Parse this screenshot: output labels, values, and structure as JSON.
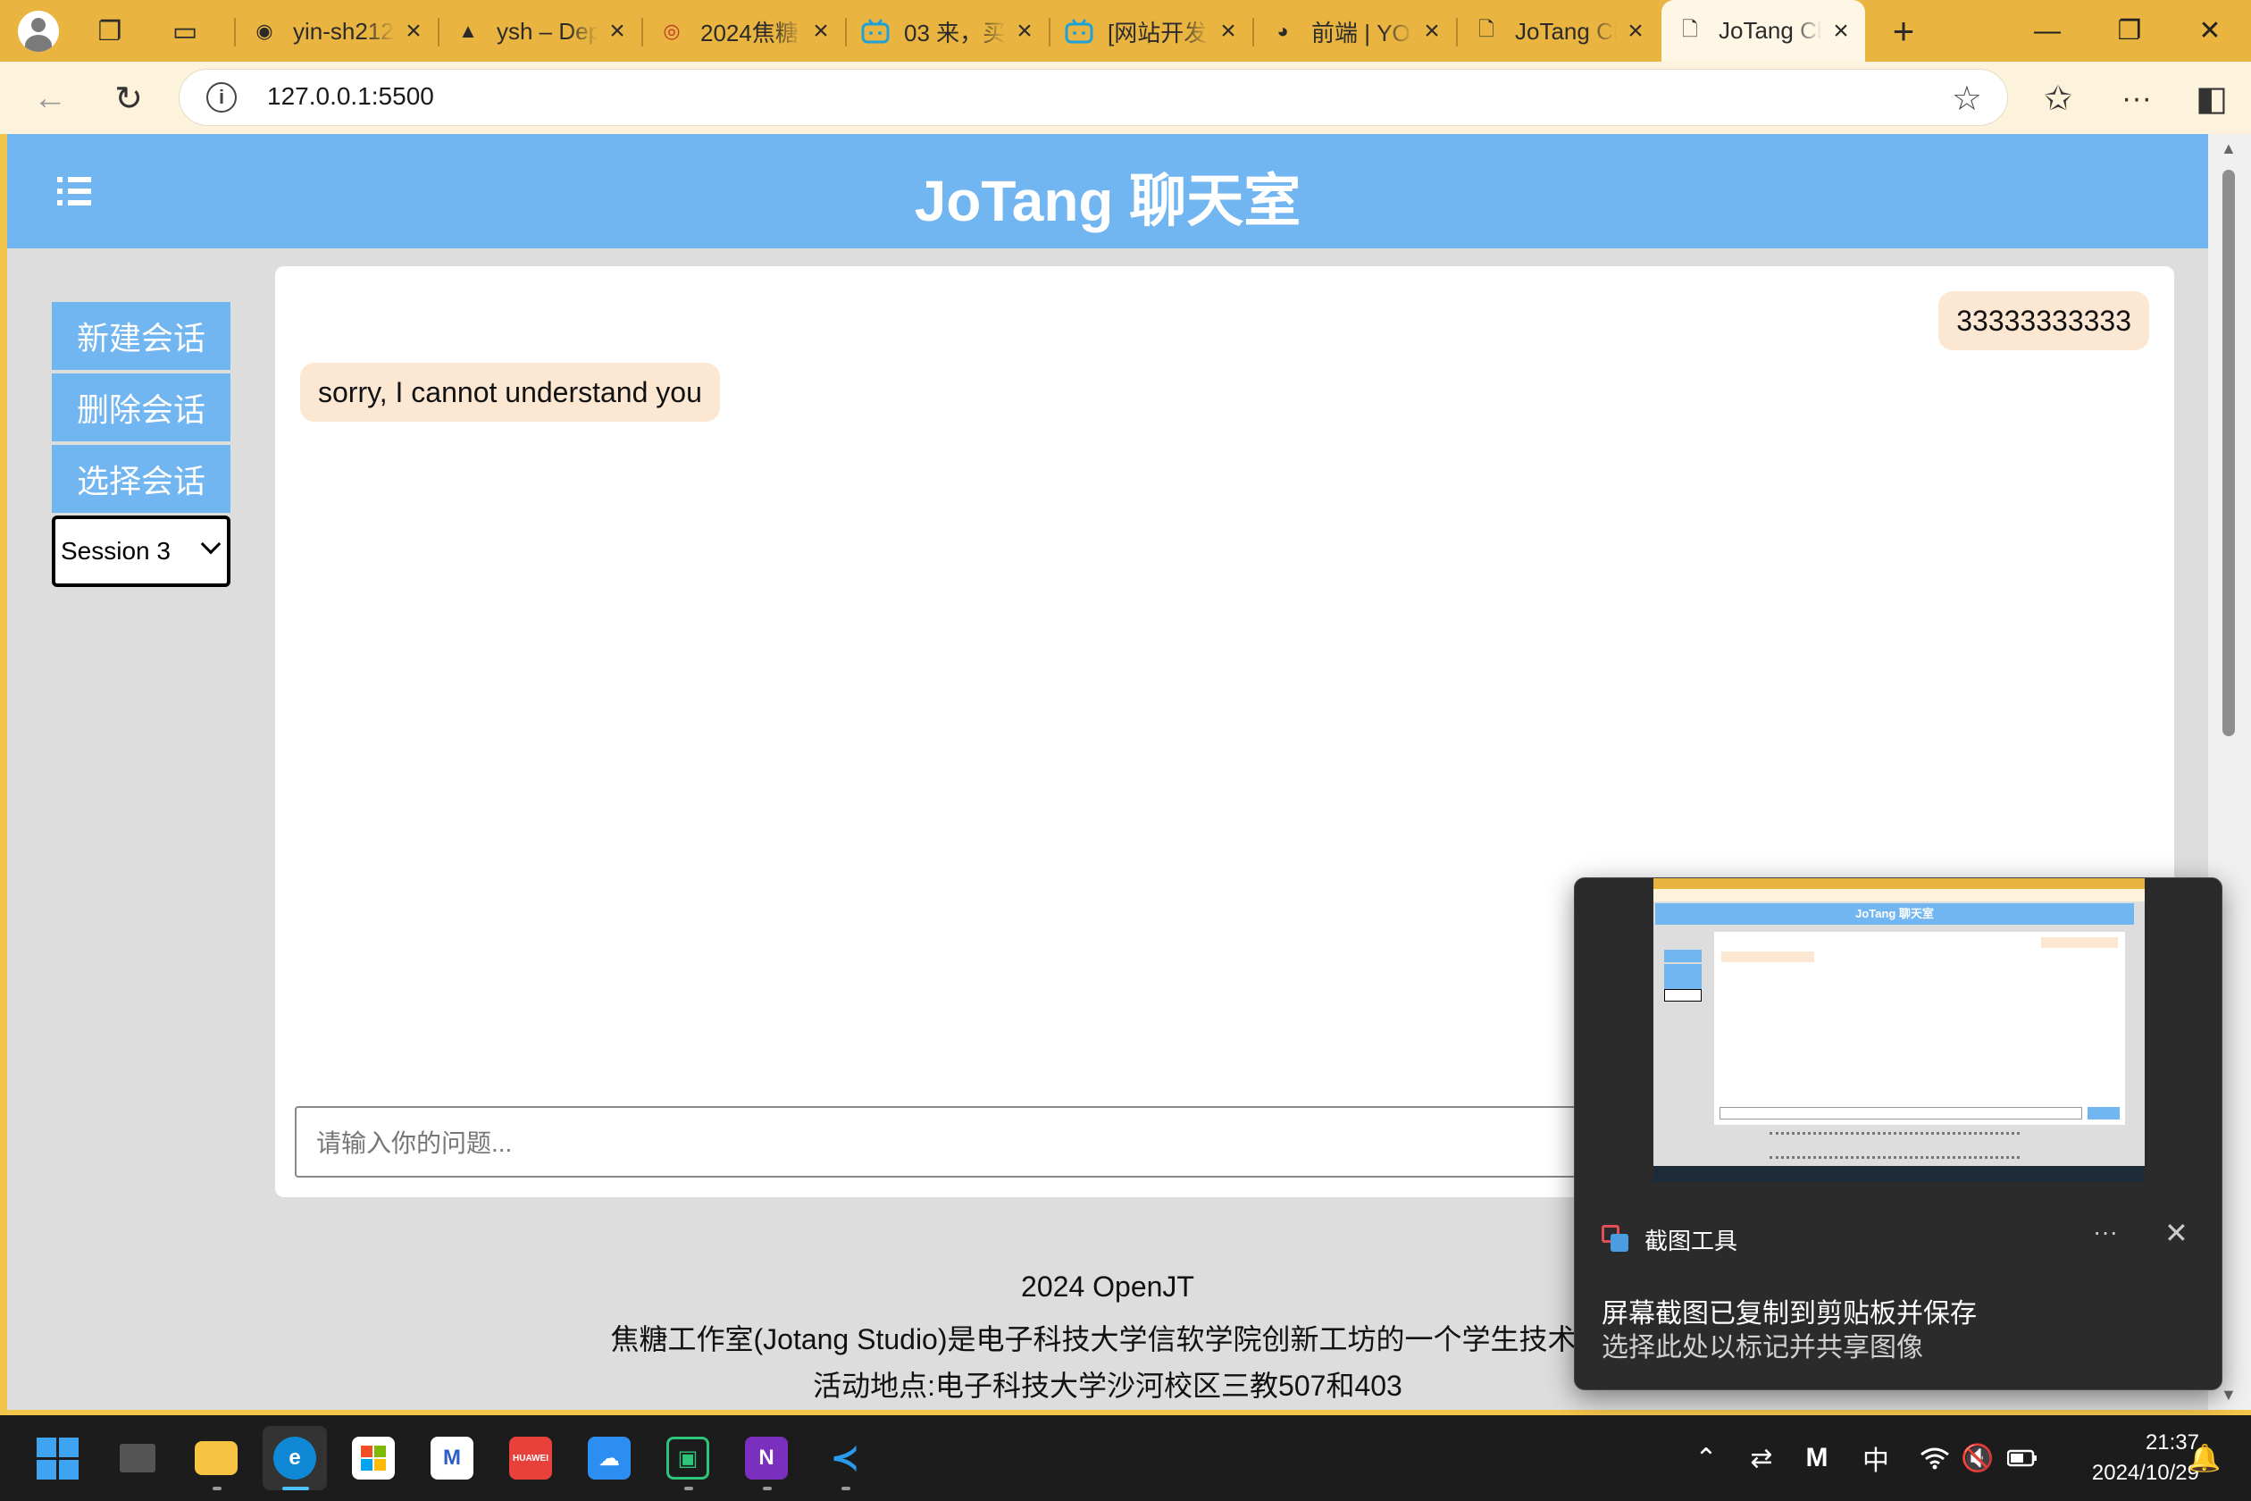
{
  "browser": {
    "tabs": [
      {
        "title": "yin-sh212",
        "icon": "github-icon",
        "glyph": "◉"
      },
      {
        "title": "ysh – Dep",
        "icon": "vercel-icon",
        "glyph": "▲"
      },
      {
        "title": "2024焦糖",
        "icon": "spiral-icon",
        "glyph": "◎"
      },
      {
        "title": "03 来，买",
        "icon": "bilibili-icon",
        "glyph": "📺"
      },
      {
        "title": "[网站开发",
        "icon": "bilibili-icon",
        "glyph": "📺"
      },
      {
        "title": "前端 | YO",
        "icon": "owl-icon",
        "glyph": "◕"
      },
      {
        "title": "JoTang Ch",
        "icon": "page-icon",
        "glyph": "🗋"
      },
      {
        "title": "JoTang Ch",
        "icon": "page-icon",
        "glyph": "🗋"
      }
    ],
    "url": "127.0.0.1:5500"
  },
  "app": {
    "title": "JoTang 聊天室",
    "sidebar": {
      "new_session": "新建会话",
      "delete_session": "删除会话",
      "select_session": "选择会话",
      "selected_session": "Session 3"
    },
    "messages": [
      {
        "role": "user",
        "text": "33333333333"
      },
      {
        "role": "bot",
        "text": "sorry, I cannot understand you"
      }
    ],
    "input_placeholder": "请输入你的问题..."
  },
  "footer": {
    "line1": "2024 OpenJT",
    "line2": "焦糖工作室(Jotang Studio)是电子科技大学信软学院创新工坊的一个学生技术团",
    "line3": "活动地点:电子科技大学沙河校区三教507和403"
  },
  "notification": {
    "app_name": "截图工具",
    "thumbnail_title": "JoTang 聊天室",
    "line1": "屏幕截图已复制到剪贴板并保存",
    "line2": "选择此处以标记并共享图像"
  },
  "taskbar": {
    "ime": "中",
    "time": "21:37",
    "date": "2024/10/29"
  },
  "colors": {
    "accent": "#71b5f1",
    "bubble": "#fbe7d2",
    "browser_frame": "#e9b440"
  }
}
